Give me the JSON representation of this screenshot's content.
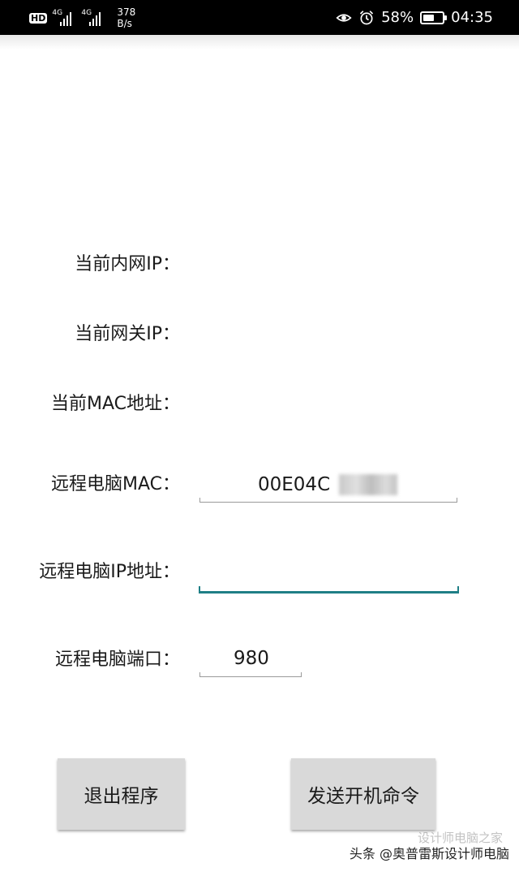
{
  "status_bar": {
    "hd_badge": "HD",
    "signal_1_label": "4G",
    "signal_2_label": "4G",
    "net_speed_value": "378",
    "net_speed_unit": "B/s",
    "icons": [
      "eye-icon",
      "alarm-icon",
      "battery-icon"
    ],
    "battery_percent": "58%",
    "battery_level": 0.58,
    "time": "04:35"
  },
  "form": {
    "local_ip_label": "当前内网IP：",
    "gateway_ip_label": "当前网关IP：",
    "local_mac_label": "当前MAC地址：",
    "remote_mac_label": "远程电脑MAC：",
    "remote_mac_value": "00E04C",
    "remote_ip_label": "远程电脑IP地址：",
    "remote_ip_value": "",
    "remote_port_label": "远程电脑端口：",
    "remote_port_value": "980"
  },
  "buttons": {
    "exit_label": "退出程序",
    "send_label": "发送开机命令"
  },
  "watermark": {
    "text": "头条 @奥普雷斯设计师电脑",
    "ghost_text": "设计师电脑之家"
  },
  "colors": {
    "status_bar_bg": "#000000",
    "focus_accent": "#1f7f86",
    "button_bg": "#d9d9d9"
  }
}
